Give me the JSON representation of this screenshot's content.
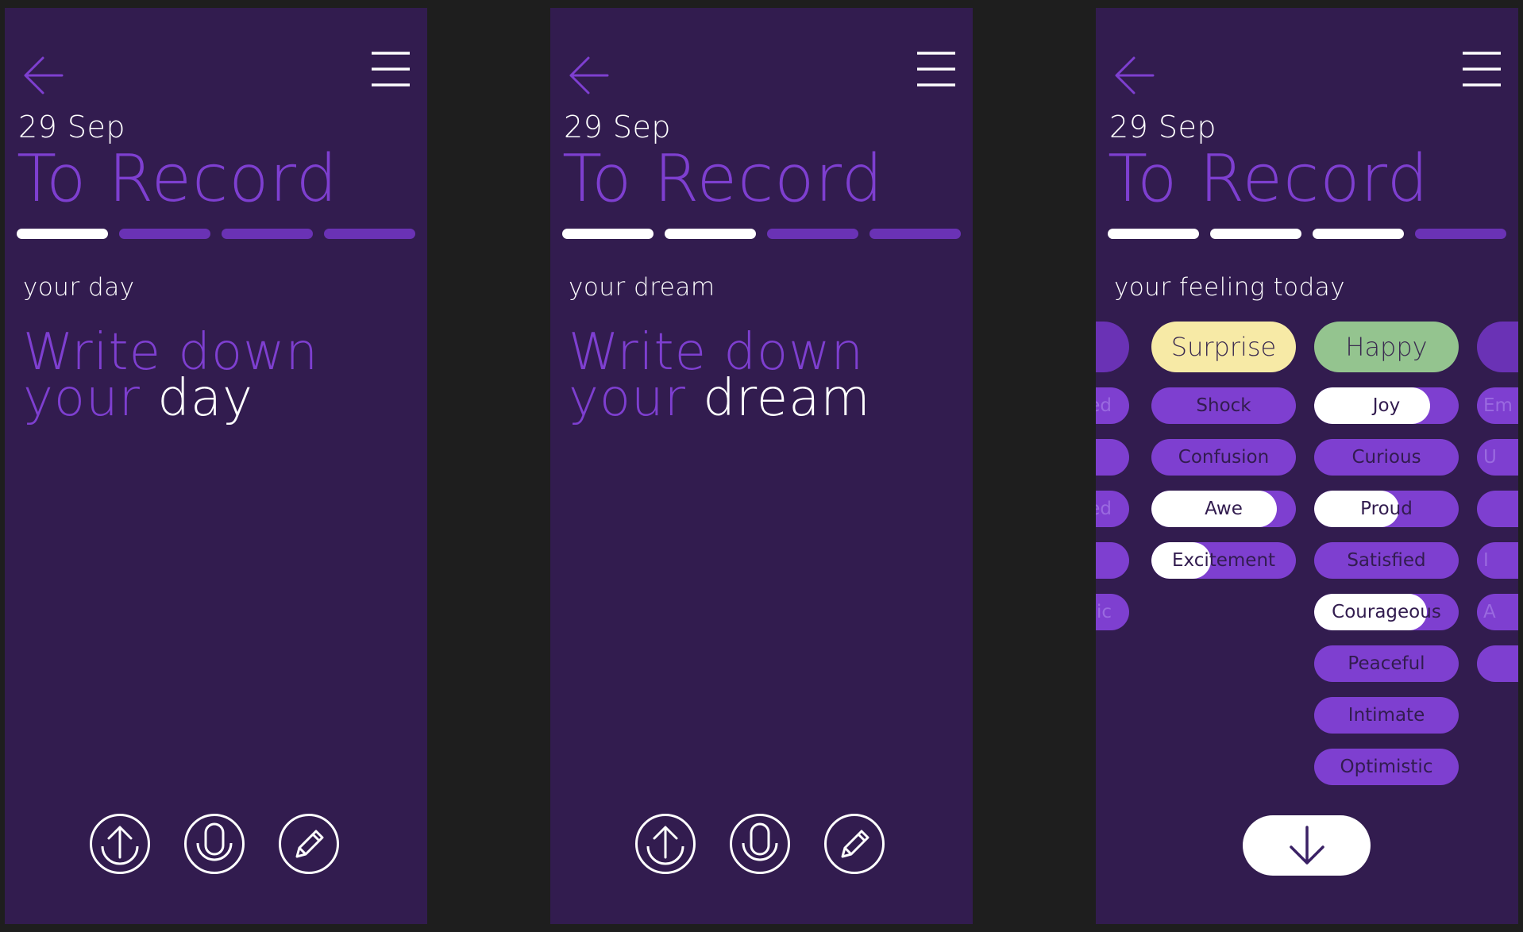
{
  "screens": [
    {
      "date": "29 Sep",
      "title": "To Record",
      "step": 1,
      "steps_total": 4,
      "subtitle": "your day",
      "prompt_line1": "Write down",
      "prompt_line2_dim": "your",
      "prompt_line2_highlight": "day"
    },
    {
      "date": "29 Sep",
      "title": "To Record",
      "step": 2,
      "steps_total": 4,
      "subtitle": "your dream",
      "prompt_line1": "Write down",
      "prompt_line2_dim": "your",
      "prompt_line2_highlight": "dream"
    },
    {
      "date": "29 Sep",
      "title": "To Record",
      "step": 3,
      "steps_total": 4,
      "subtitle": "your feeling today",
      "emotions": {
        "left_partial": [
          "ed",
          "",
          "ed",
          "",
          "ic"
        ],
        "surprise": {
          "label": "Surprise",
          "color": "#f7eaa6",
          "items": [
            {
              "label": "Shock",
              "level": 0
            },
            {
              "label": "Confusion",
              "level": 0
            },
            {
              "label": "Awe",
              "level": 0.87
            },
            {
              "label": "Excitement",
              "level": 0.41
            }
          ]
        },
        "happy": {
          "label": "Happy",
          "color": "#94c48f",
          "items": [
            {
              "label": "Joy",
              "level": 0.8
            },
            {
              "label": "Curious",
              "level": 0
            },
            {
              "label": "Proud",
              "level": 0.59
            },
            {
              "label": "Satisfied",
              "level": 0
            },
            {
              "label": "Courageous",
              "level": 0.78
            },
            {
              "label": "Peaceful",
              "level": 0
            },
            {
              "label": "Intimate",
              "level": 0
            },
            {
              "label": "Optimistic",
              "level": 0
            }
          ]
        },
        "right_partial": [
          "Em",
          "U",
          "",
          "I",
          "A",
          ""
        ]
      }
    }
  ],
  "colors": {
    "background": "#1e1e1e",
    "screen": "#321c4f",
    "accent": "#7e3fd0",
    "inactive_segment": "#6a32b5",
    "active": "#ffffff"
  },
  "icons": {
    "back": "arrow-left-icon",
    "menu": "hamburger-menu-icon",
    "upload": "upload-icon",
    "voice": "microphone-icon",
    "write": "pencil-icon",
    "next": "arrow-down-icon"
  }
}
